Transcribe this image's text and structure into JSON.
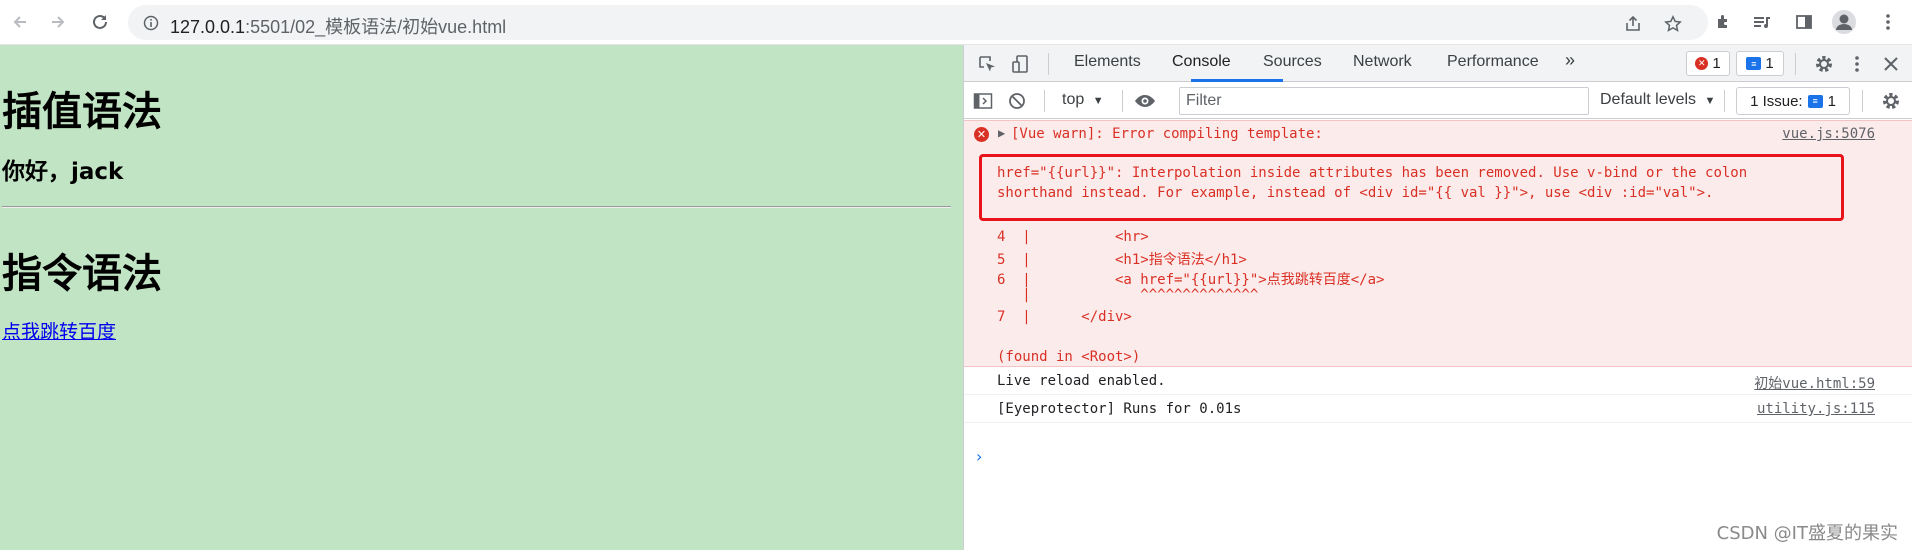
{
  "browser": {
    "url_host": "127.0.0.1",
    "url_path": ":5501/02_模板语法/初始vue.html"
  },
  "page": {
    "heading_interpolation": "插值语法",
    "greeting": "你好，jack",
    "heading_directive": "指令语法",
    "link_text": "点我跳转百度"
  },
  "devtools": {
    "tabs": [
      {
        "label": "Elements",
        "active": false
      },
      {
        "label": "Console",
        "active": true
      },
      {
        "label": "Sources",
        "active": false
      },
      {
        "label": "Network",
        "active": false
      },
      {
        "label": "Performance",
        "active": false
      }
    ],
    "more_tabs": "»",
    "error_count": "1",
    "message_count": "1",
    "context": "top",
    "filter_placeholder": "Filter",
    "levels": "Default levels",
    "issues_label": "1 Issue:",
    "issues_count": "1"
  },
  "console": {
    "error_title": "[Vue warn]: Error compiling template:",
    "error_source": "vue.js:5076",
    "error_message_line1": "href=\"{{url}}\": Interpolation inside attributes has been removed. Use v-bind or the colon",
    "error_message_line2": "shorthand instead. For example, instead of <div id=\"{{ val }}\">, use <div :id=\"val\">.",
    "code_lines": [
      "4  |          <hr>",
      "5  |          <h1>指令语法</h1>",
      "6  |          <a href=\"{{url}}\">点我跳转百度</a>",
      "   |             ^^^^^^^^^^^^^^",
      "7  |      </div>"
    ],
    "found_in": "(found in <Root>)",
    "logs": [
      {
        "text": "Live reload enabled.",
        "source": "初始vue.html:59"
      },
      {
        "text": "[Eyeprotector] Runs for 0.01s",
        "source": "utility.js:115"
      }
    ],
    "prompt": "›"
  },
  "watermark": "CSDN @IT盛夏的果实",
  "colors": {
    "page_background": "#c1e4c4",
    "error_red": "#d93025",
    "highlight_box": "#e8141a",
    "accent_blue": "#1a73e8"
  }
}
